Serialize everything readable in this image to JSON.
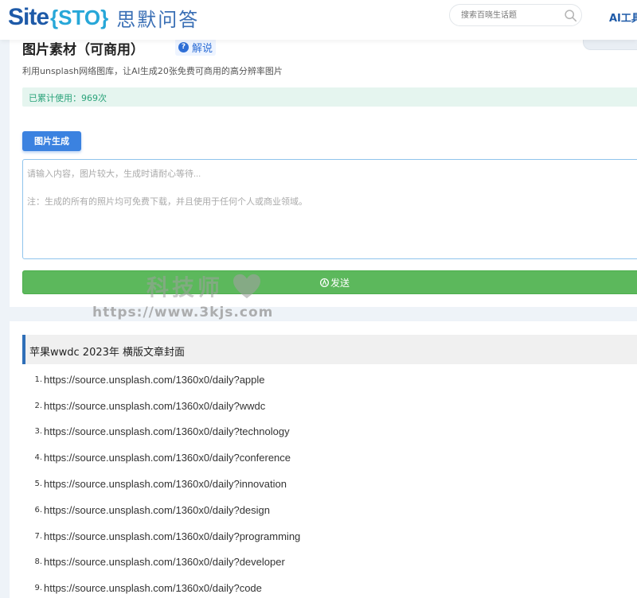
{
  "header": {
    "logo_site": "Site",
    "logo_sto": "{STO}",
    "logo_cn": "思默问答",
    "search_placeholder": "搜索百晓生话题",
    "ai_tools": "AI工具"
  },
  "tool": {
    "title": "图片素材（可商用）",
    "help_label": "解说",
    "subtitle": "利用unsplash网络图库，让AI生成20张免费可商用的高分辨率图片",
    "usage": "已累计使用：969次",
    "tab_label": "图片生成",
    "prompt_placeholder": "请输入内容，图片较大，生成时请耐心等待...",
    "prompt_note": "注：生成的所有的照片均可免费下载，并且使用于任何个人或商业领域。",
    "send_label": "发送"
  },
  "watermark": {
    "title": "科技师",
    "url": "https://www.3kjs.com"
  },
  "results": {
    "heading": "苹果wwdc 2023年 横版文章封面",
    "items": [
      {
        "num": "1.",
        "url": "https://source.unsplash.com/1360x0/daily?apple"
      },
      {
        "num": "2.",
        "url": "https://source.unsplash.com/1360x0/daily?wwdc"
      },
      {
        "num": "3.",
        "url": "https://source.unsplash.com/1360x0/daily?technology"
      },
      {
        "num": "4.",
        "url": "https://source.unsplash.com/1360x0/daily?conference"
      },
      {
        "num": "5.",
        "url": "https://source.unsplash.com/1360x0/daily?innovation"
      },
      {
        "num": "6.",
        "url": "https://source.unsplash.com/1360x0/daily?design"
      },
      {
        "num": "7.",
        "url": "https://source.unsplash.com/1360x0/daily?programming"
      },
      {
        "num": "8.",
        "url": "https://source.unsplash.com/1360x0/daily?developer"
      },
      {
        "num": "9.",
        "url": "https://source.unsplash.com/1360x0/daily?code"
      }
    ]
  },
  "colors": {
    "brand_blue": "#1e5aa8",
    "accent_blue": "#3b82e0",
    "send_green": "#5cb85c",
    "usage_green": "#2aa37a"
  }
}
